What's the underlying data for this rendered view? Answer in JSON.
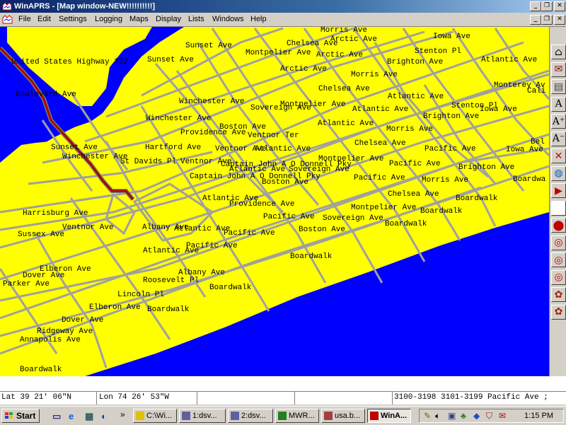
{
  "window": {
    "title": "WinAPRS - [Map window-NEW!!!!!!!!!!]",
    "min_glyph": "_",
    "restore_glyph": "❐",
    "close_glyph": "✕"
  },
  "menu": {
    "items": [
      "File",
      "Edit",
      "Settings",
      "Logging",
      "Maps",
      "Display",
      "Lists",
      "Windows",
      "Help"
    ]
  },
  "map": {
    "colors": {
      "land": "#ffff00",
      "water": "#0000ff",
      "road": "#a0a0a0",
      "route": "#b00000"
    },
    "labels": [
      {
        "t": "Morris Ave"
      },
      {
        "t": "Iowa Ave"
      },
      {
        "t": "Chelsea Ave"
      },
      {
        "t": "Arctic Ave"
      },
      {
        "t": "Sunset Ave"
      },
      {
        "t": "Montpelier Ave"
      },
      {
        "t": "Arctic Ave"
      },
      {
        "t": "Stenton Pl"
      },
      {
        "t": "Sunset Ave"
      },
      {
        "t": "Brighton Ave"
      },
      {
        "t": "Atlantic Ave"
      },
      {
        "t": "United States Highway 322"
      },
      {
        "t": "Arctic Ave"
      },
      {
        "t": "Morris Ave"
      },
      {
        "t": "Monterey Av"
      },
      {
        "t": "Cali"
      },
      {
        "t": "Boulevard Ave"
      },
      {
        "t": "Chelsea Ave"
      },
      {
        "t": "Atlantic Ave"
      },
      {
        "t": "Winchester Ave"
      },
      {
        "t": "Montpelier Ave"
      },
      {
        "t": "Stenton Pl"
      },
      {
        "t": "Sovereign Ave"
      },
      {
        "t": "Atlantic Ave"
      },
      {
        "t": "Iowa Ave"
      },
      {
        "t": "Winchester Ave"
      },
      {
        "t": "Brighton Ave"
      },
      {
        "t": "Boston Ave"
      },
      {
        "t": "Atlantic Ave"
      },
      {
        "t": "Providence Ave"
      },
      {
        "t": "Ventnor Ter"
      },
      {
        "t": "Morris Ave"
      },
      {
        "t": "Sunset Ave"
      },
      {
        "t": "Hartford Ave"
      },
      {
        "t": "Ventnor Ave"
      },
      {
        "t": "Atlantic Ave"
      },
      {
        "t": "Chelsea Ave"
      },
      {
        "t": "Pacific Ave"
      },
      {
        "t": "Iowa Ave"
      },
      {
        "t": "Bel"
      },
      {
        "t": "Winchester Ave"
      },
      {
        "t": "Montpelier Ave"
      },
      {
        "t": "St Davids Pl"
      },
      {
        "t": "Ventnor Ave"
      },
      {
        "t": "Captain John A O Donnell Pky"
      },
      {
        "t": "Pacific Ave"
      },
      {
        "t": "Atlantic Ave"
      },
      {
        "t": "Sovereign Ave"
      },
      {
        "t": "Brighton Ave"
      },
      {
        "t": "Captain John A O Donnell Pky"
      },
      {
        "t": "Pacific Ave"
      },
      {
        "t": "Morris Ave"
      },
      {
        "t": "Boardwa"
      },
      {
        "t": "Boston Ave"
      },
      {
        "t": "Chelsea Ave"
      },
      {
        "t": "Atlantic Ave"
      },
      {
        "t": "Boardwalk"
      },
      {
        "t": "Providence Ave"
      },
      {
        "t": "Montpelier Ave"
      },
      {
        "t": "Boardwalk"
      },
      {
        "t": "Harrisburg Ave"
      },
      {
        "t": "Pacific Ave"
      },
      {
        "t": "Sovereign Ave"
      },
      {
        "t": "Boardwalk"
      },
      {
        "t": "Ventnor Ave"
      },
      {
        "t": "Albany Ave"
      },
      {
        "t": "Atlantic Ave"
      },
      {
        "t": "Boston Ave"
      },
      {
        "t": "Sussex Ave"
      },
      {
        "t": "Pacific Ave"
      },
      {
        "t": "Pacific Ave"
      },
      {
        "t": "Atlantic Ave"
      },
      {
        "t": "Boardwalk"
      },
      {
        "t": "Elberon Ave"
      },
      {
        "t": "Albany Ave"
      },
      {
        "t": "Dover Ave"
      },
      {
        "t": "Roosevelt Pl"
      },
      {
        "t": "Parker Ave"
      },
      {
        "t": "Boardwalk"
      },
      {
        "t": "Lincoln Pl"
      },
      {
        "t": "Elberon Ave"
      },
      {
        "t": "Boardwalk"
      },
      {
        "t": "Dover Ave"
      },
      {
        "t": "Ridgeway Ave"
      },
      {
        "t": "Annapolis Ave"
      },
      {
        "t": "Boardwalk"
      }
    ]
  },
  "toolbar": {
    "buttons": [
      {
        "name": "home-icon",
        "glyph": "⌂"
      },
      {
        "name": "map-icon",
        "glyph": "✉"
      },
      {
        "name": "print-icon",
        "glyph": "▤"
      },
      {
        "name": "font-icon",
        "glyph": "A"
      },
      {
        "name": "font-larger-icon",
        "glyph": "A⁺"
      },
      {
        "name": "font-smaller-icon",
        "glyph": "A⁻"
      },
      {
        "name": "delete-icon",
        "glyph": "✕"
      },
      {
        "name": "globe-icon",
        "glyph": "◍"
      },
      {
        "name": "play-icon",
        "glyph": "▶"
      },
      {
        "name": "blank-icon",
        "glyph": ""
      },
      {
        "name": "pin-icon",
        "glyph": "⬤"
      },
      {
        "name": "target-icon",
        "glyph": "◎"
      },
      {
        "name": "target-icon-2",
        "glyph": "◎"
      },
      {
        "name": "target-icon-3",
        "glyph": "◎"
      },
      {
        "name": "flower-icon",
        "glyph": "✿"
      },
      {
        "name": "flower-icon-2",
        "glyph": "✿"
      }
    ]
  },
  "status": {
    "lat": "Lat  39 21' 06\"N",
    "lon": "Lon  74 26' 53\"W",
    "address": "3100-3198 3101-3199  Pacific Ave ;"
  },
  "taskbar": {
    "start_label": "Start",
    "quick_icons": [
      "desktop-icon",
      "browser-icon",
      "network-icon",
      "messenger-icon"
    ],
    "more_glyph": "»",
    "tasks": [
      {
        "label": "C:\\Wi...",
        "active": false
      },
      {
        "label": "1:dsv...",
        "active": false
      },
      {
        "label": "2:dsv...",
        "active": false
      },
      {
        "label": "MWR...",
        "active": false
      },
      {
        "label": "usa.b...",
        "active": false
      },
      {
        "label": "WinA...",
        "active": true
      }
    ],
    "clock": "1:15 PM"
  }
}
